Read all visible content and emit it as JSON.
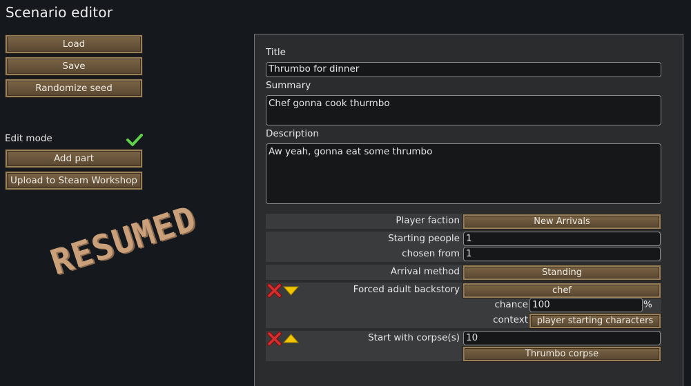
{
  "window": {
    "title": "Scenario editor"
  },
  "left": {
    "load_label": "Load",
    "save_label": "Save",
    "randomize_label": "Randomize seed",
    "edit_mode_label": "Edit mode",
    "add_part_label": "Add part",
    "upload_label": "Upload to Steam Workshop",
    "stamp_text": "RESUMED"
  },
  "form": {
    "title_label": "Title",
    "title_value": "Thrumbo for dinner",
    "summary_label": "Summary",
    "summary_value": "Chef gonna cook thurmbo",
    "description_label": "Description",
    "description_value": "Aw yeah, gonna eat some thrumbo"
  },
  "parts": {
    "player_faction_label": "Player faction",
    "player_faction_value": "New Arrivals",
    "starting_people_label": "Starting people",
    "starting_people_value": "1",
    "chosen_from_label": "chosen from",
    "chosen_from_value": "1",
    "arrival_method_label": "Arrival method",
    "arrival_method_value": "Standing",
    "backstory_label": "Forced adult backstory",
    "backstory_value": "chef",
    "chance_label": "chance",
    "chance_value": "100",
    "chance_unit": "%",
    "context_label": "context",
    "context_value": "player starting characters",
    "corpse_label": "Start with corpse(s)",
    "corpse_count": "10",
    "corpse_value": "Thrumbo corpse"
  },
  "icons": {
    "check": "check-icon",
    "remove": "x-icon",
    "move_down": "triangle-down-icon",
    "move_up": "triangle-up-icon"
  },
  "colors": {
    "button_fill": "#6a553b",
    "panel": "#2b2c2d",
    "row": "#3a3b3c",
    "remove_red": "#c62b2b",
    "arrow_yellow": "#f1c500",
    "check_green": "#5fd14a"
  }
}
